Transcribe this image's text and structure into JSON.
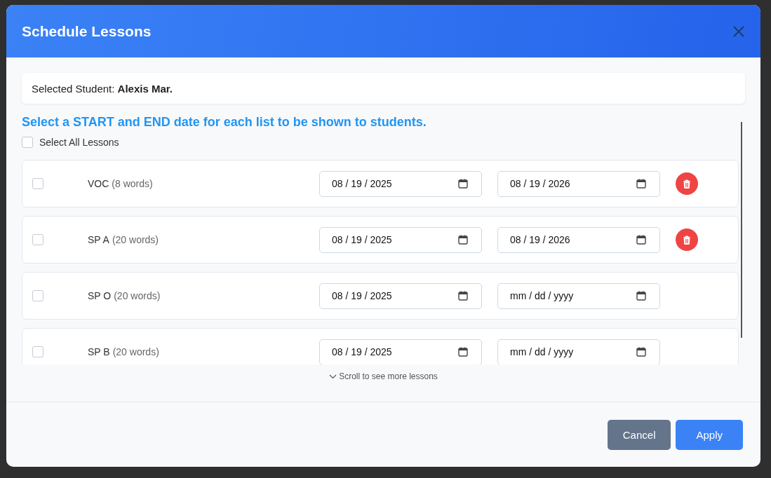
{
  "dialog": {
    "title": "Schedule Lessons",
    "selected_student": {
      "label": "Selected Student:",
      "name": "Alexis Mar."
    },
    "instruction": "Select a START and END date for each list to be shown to students.",
    "select_all": {
      "label": "Select All Lessons",
      "checked": false
    },
    "lessons": [
      {
        "name": "VOC",
        "count": "(8 words)",
        "checked": false,
        "start": {
          "value": "08 / 19 / 2025"
        },
        "end": {
          "value": "08 / 19 / 2026"
        },
        "deletable": true
      },
      {
        "name": "SP A",
        "count": "(20 words)",
        "checked": false,
        "start": {
          "value": "08 / 19 / 2025"
        },
        "end": {
          "value": "08 / 19 / 2026"
        },
        "deletable": true
      },
      {
        "name": "SP O",
        "count": "(20 words)",
        "checked": false,
        "start": {
          "value": "08 / 19 / 2025"
        },
        "end": {
          "placeholder": "mm / dd / yyyy"
        },
        "deletable": false
      },
      {
        "name": "SP B",
        "count": "(20 words)",
        "checked": false,
        "start": {
          "value": "08 / 19 / 2025"
        },
        "end": {
          "placeholder": "mm / dd / yyyy"
        },
        "deletable": false
      }
    ],
    "scroll_hint": "Scroll to see more lessons",
    "buttons": [
      {
        "label": "Cancel",
        "kind": "secondary"
      },
      {
        "label": "Apply",
        "kind": "primary"
      }
    ]
  }
}
